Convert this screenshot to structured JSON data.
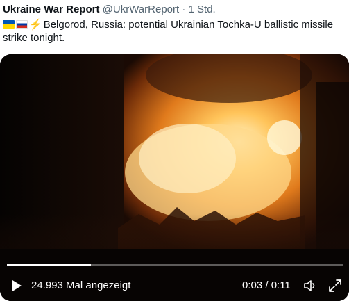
{
  "tweet": {
    "author_name": "Ukraine War Report",
    "handle": "@UkrWarReport",
    "separator": "·",
    "time": "1 Std.",
    "text": "Belgorod, Russia: potential Ukrainian Tochka-U ballistic missile strike tonight.",
    "emojis": [
      "flag-ukraine",
      "flag-russia",
      "high-voltage"
    ]
  },
  "video": {
    "views": "24.993 Mal angezeigt",
    "time_readout": "0:03 / 0:11",
    "progress": 0.25,
    "icons": [
      "play-icon",
      "volume-icon",
      "fullscreen-icon"
    ]
  }
}
